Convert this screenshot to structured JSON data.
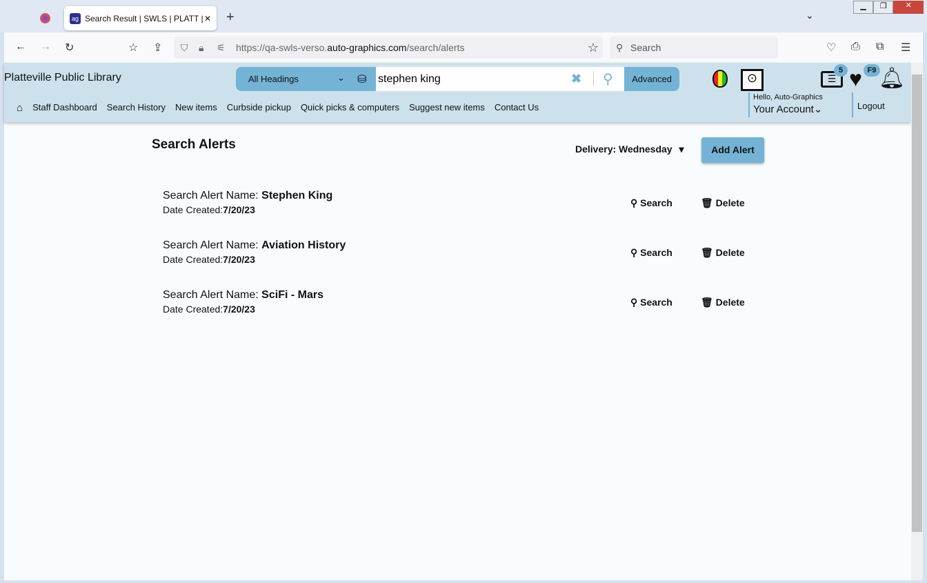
{
  "browser": {
    "tab_title": "Search Result | SWLS | PLATT | A",
    "url_prefix": "https://qa-swls-verso.",
    "url_domain": "auto-graphics.com",
    "url_path": "/search/alerts",
    "search_placeholder": "Search"
  },
  "header": {
    "library_name": "Platteville Public Library",
    "search_scope": "All Headings",
    "search_value": "stephen king",
    "advanced_label": "Advanced",
    "list_badge": "5",
    "favorites_badge": "F9",
    "greeting": "Hello, Auto-Graphics",
    "account_label": "Your Account",
    "logout_label": "Logout"
  },
  "nav": [
    "Staff Dashboard",
    "Search History",
    "New items",
    "Curbside pickup",
    "Quick picks & computers",
    "Suggest new items",
    "Contact Us"
  ],
  "main": {
    "title": "Search Alerts",
    "delivery_label": "Delivery: Wednesday",
    "add_alert_label": "Add Alert",
    "name_prefix": "Search Alert Name: ",
    "date_prefix": "Date Created:",
    "search_label": "Search",
    "delete_label": "Delete",
    "alerts": [
      {
        "name": "Stephen King",
        "date": "7/20/23"
      },
      {
        "name": "Aviation History",
        "date": "7/20/23"
      },
      {
        "name": "SciFi - Mars",
        "date": "7/20/23"
      }
    ]
  },
  "colors": {
    "accent": "#74b3d6",
    "header_bg": "#cde1ec"
  }
}
